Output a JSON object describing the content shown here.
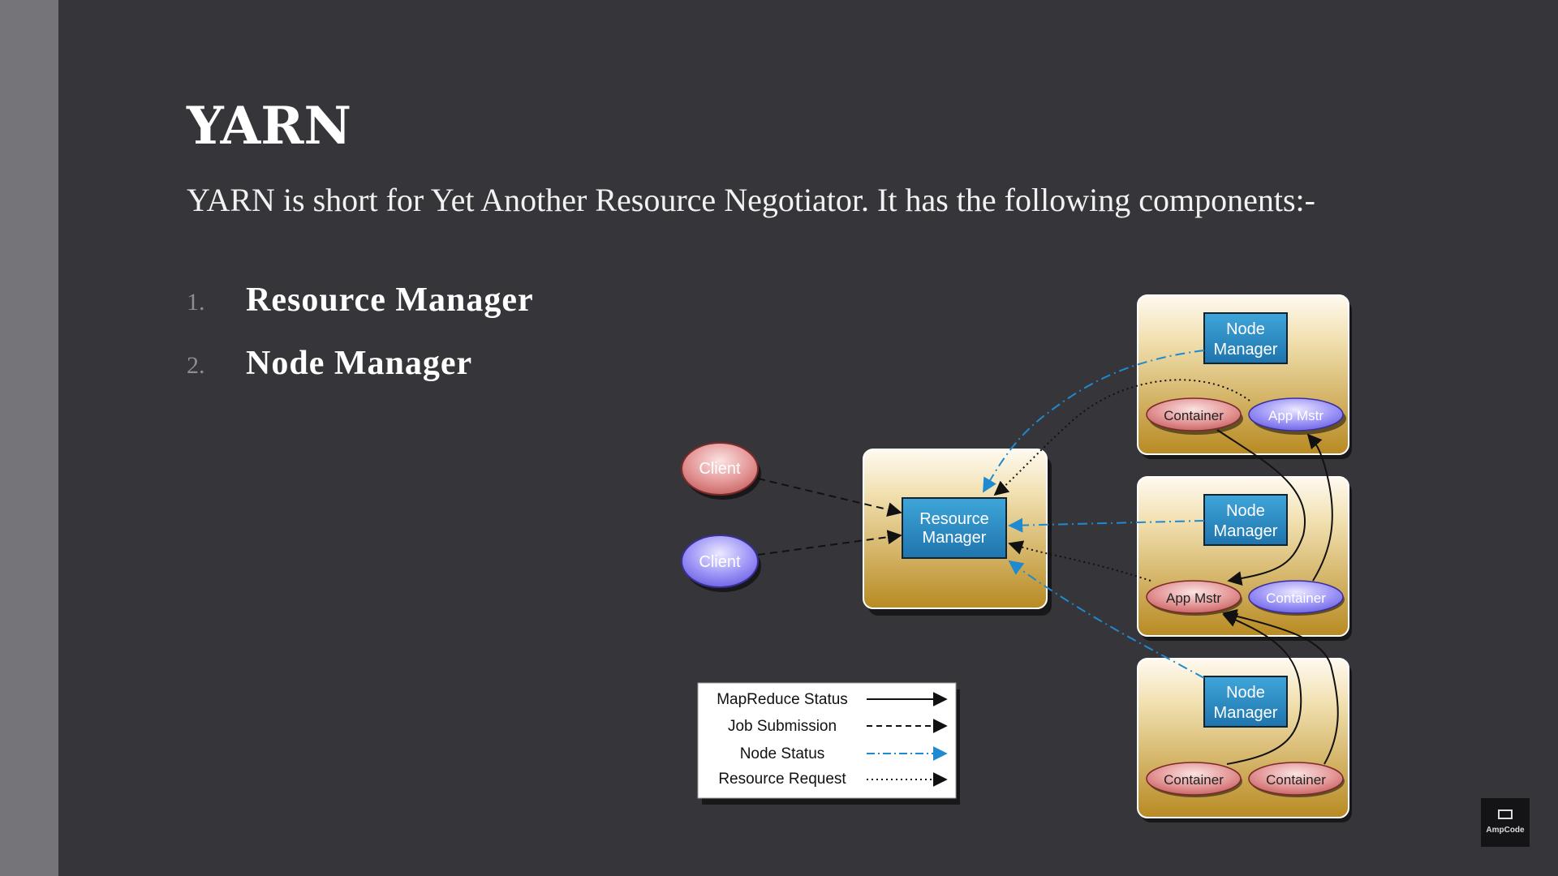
{
  "slide": {
    "title": "YARN",
    "intro": "YARN is short for Yet Another Resource Negotiator. It has the following components:-",
    "list": [
      {
        "num": "1.",
        "text": "Resource Manager"
      },
      {
        "num": "2.",
        "text": "Node Manager"
      }
    ]
  },
  "diagram": {
    "clients": [
      "Client",
      "Client"
    ],
    "resource_manager": [
      "Resource",
      "Manager"
    ],
    "node_manager": [
      "Node",
      "Manager"
    ],
    "node1": {
      "left": "Container",
      "right": "App Mstr"
    },
    "node2": {
      "left": "App Mstr",
      "right": "Container"
    },
    "node3": {
      "left": "Container",
      "right": "Container"
    },
    "legend": [
      "MapReduce Status",
      "Job Submission",
      "Node Status",
      "Resource Request"
    ]
  },
  "logo": {
    "text": "AmpCode"
  },
  "colors": {
    "background": "#36363a",
    "sidebar": "#757479",
    "box_gold": "#c49a2c",
    "manager_blue": "#2f8fc6",
    "pink_oval": "#d97f7f",
    "purple_oval": "#8a80f2",
    "node_status_arrow": "#1f8ad0"
  }
}
